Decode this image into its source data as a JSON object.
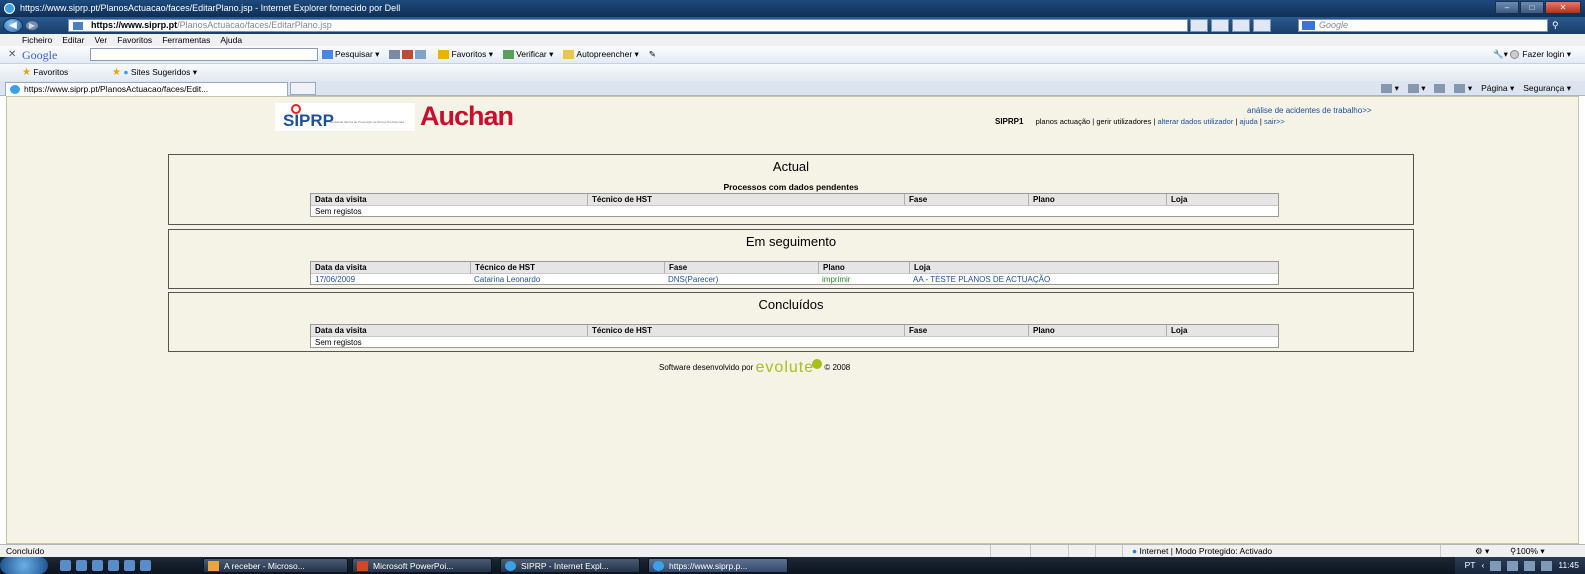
{
  "window": {
    "title": "https://www.siprp.pt/PlanosActuacao/faces/EditarPlano.jsp - Internet Explorer fornecido por Dell"
  },
  "address": {
    "host": "https://www.siprp.pt",
    "path": "/PlanosActuacao/faces/EditarPlano.jsp",
    "search_placeholder": "Google"
  },
  "menu": [
    "Ficheiro",
    "Editar",
    "Ver",
    "Favoritos",
    "Ferramentas",
    "Ajuda"
  ],
  "google_toolbar": {
    "logo": "Google",
    "search": "Pesquisar",
    "favorites": "Favoritos",
    "check": "Verificar",
    "autofill": "Autopreencher",
    "login": "Fazer login"
  },
  "favorites_bar": {
    "favorites": "Favoritos",
    "suggested": "Sites Sugeridos"
  },
  "tab": {
    "label": "https://www.siprp.pt/PlanosActuacao/faces/Edit..."
  },
  "command_bar": {
    "page": "Página",
    "security": "Segurança"
  },
  "page": {
    "logo_siprp": "SIPRP",
    "logo_siprp_sub": "Sociedade Ibérica de Prevenção de Riscos Profissionais",
    "logo_auchan": "Auchan",
    "top_link": "análise de acidentes de trabalho>>",
    "brand": "SIPRP1",
    "nav": {
      "plans": "planos actuação",
      "users": "gerir utilizadores",
      "edit_user": "alterar dados utilizador",
      "help": "ajuda",
      "exit": "sair>>"
    },
    "sections": {
      "actual": {
        "title": "Actual",
        "subtitle": "Processos com dados pendentes",
        "columns": [
          "Data da visita",
          "Técnico de HST",
          "Fase",
          "Plano",
          "Loja"
        ],
        "empty": "Sem registos"
      },
      "following": {
        "title": "Em seguimento",
        "columns": [
          "Data da visita",
          "Técnico de HST",
          "Fase",
          "Plano",
          "Loja"
        ],
        "rows": [
          [
            "17/06/2009",
            "Catarina Leonardo",
            "DNS(Parecer)",
            "imprimir",
            "AA - TESTE PLANOS DE ACTUAÇÃO"
          ]
        ]
      },
      "done": {
        "title": "Concluídos",
        "columns": [
          "Data da visita",
          "Técnico de HST",
          "Fase",
          "Plano",
          "Loja"
        ],
        "empty": "Sem registos"
      }
    },
    "footer": {
      "text": "Software desenvolvido por",
      "brand": "evolute",
      "year": "© 2008"
    }
  },
  "status": {
    "left": "Concluído",
    "zone": "Internet | Modo Protegido: Activado",
    "zoom": "100%"
  },
  "taskbar": {
    "buttons": [
      "A receber - Microso...",
      "Microsoft PowerPoi...",
      "SIPRP - Internet Expl...",
      "https://www.siprp.p..."
    ],
    "lang": "PT",
    "time": "11:45"
  }
}
